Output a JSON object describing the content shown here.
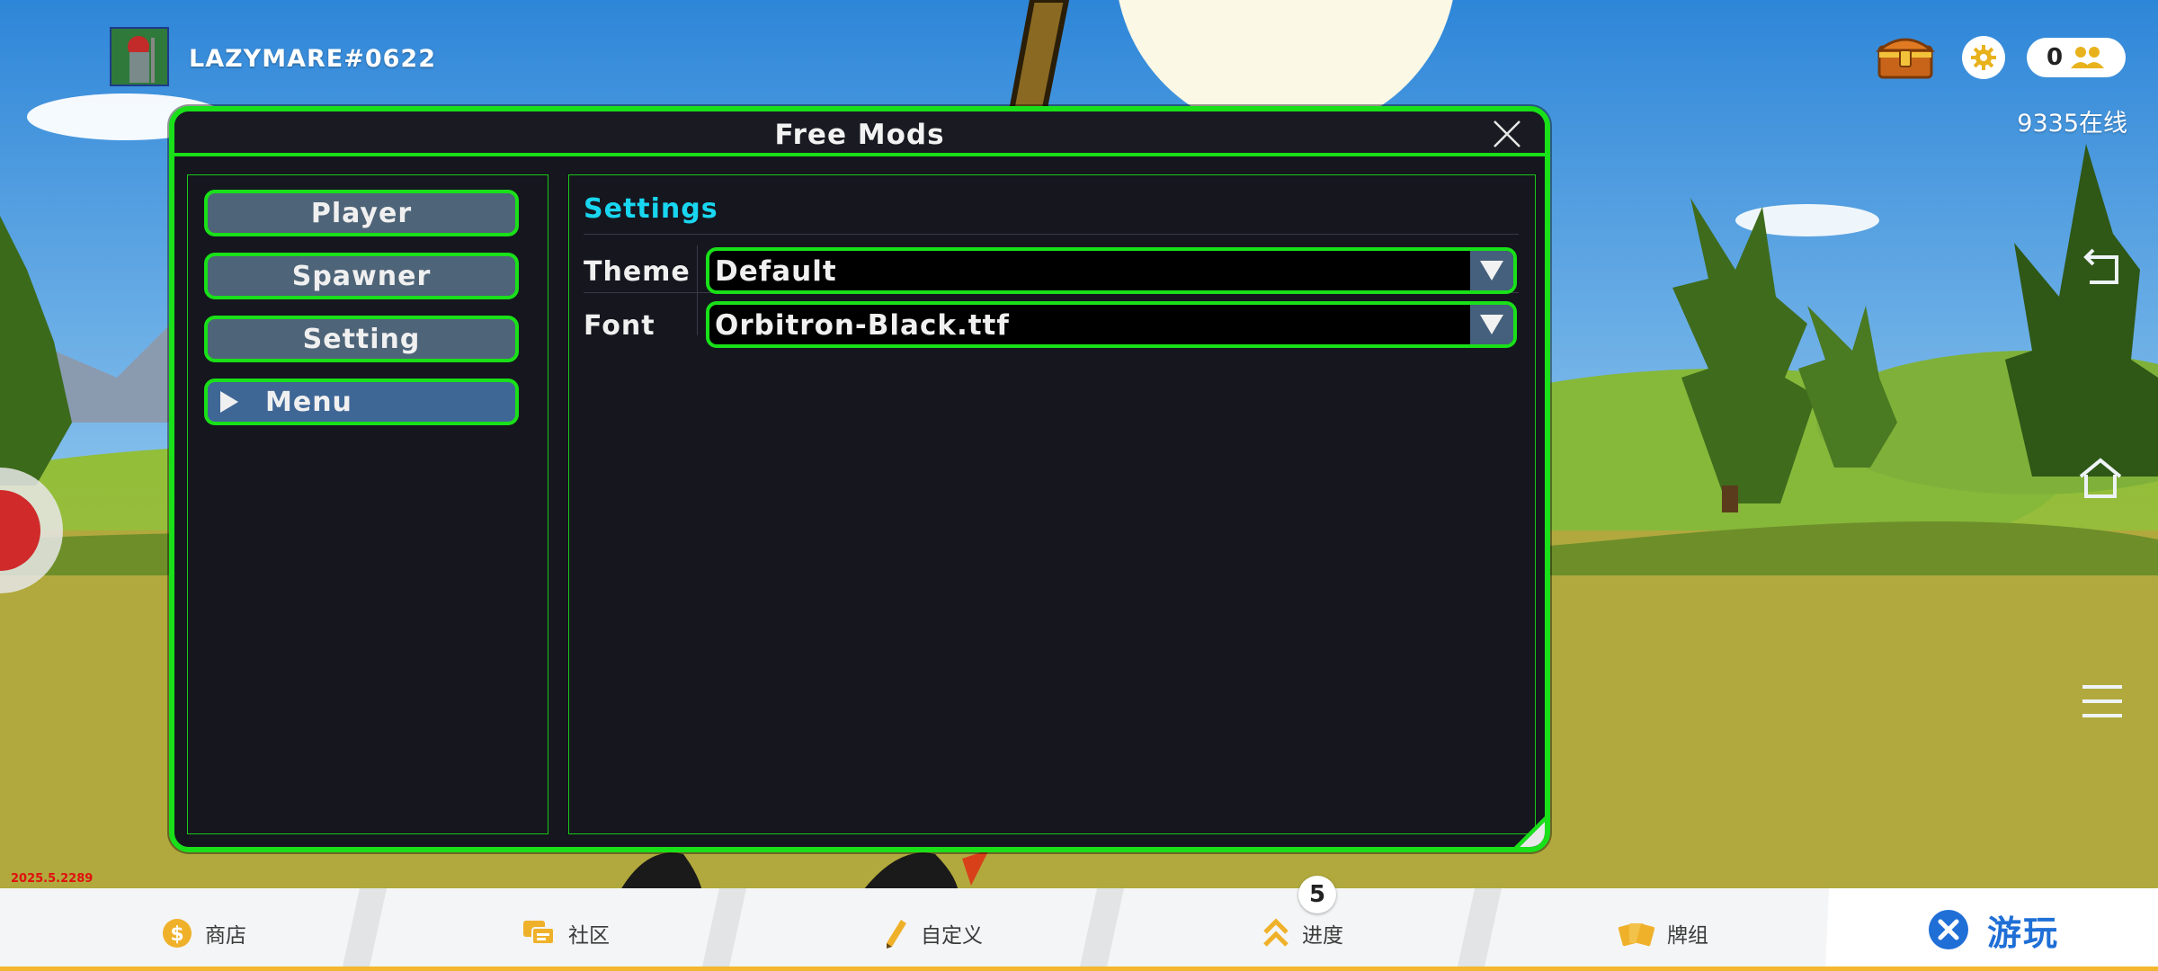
{
  "player": {
    "name": "LAZYMARE#0622"
  },
  "top_right": {
    "friends_count": "0",
    "online_status": "9335在线"
  },
  "version": "2025.5.2289",
  "modal": {
    "title": "Free Mods",
    "nav": [
      {
        "label": "Player",
        "active": false
      },
      {
        "label": "Spawner",
        "active": false
      },
      {
        "label": "Setting",
        "active": false
      },
      {
        "label": "Menu",
        "active": true
      }
    ],
    "section_title": "Settings",
    "theme": {
      "label": "Theme",
      "value": "Default"
    },
    "font": {
      "label": "Font",
      "value": "Orbitron-Black.ttf"
    }
  },
  "bottom_nav": {
    "shop": "商店",
    "community": "社区",
    "customize": "自定义",
    "progress": "进度",
    "progress_badge": "5",
    "decks": "牌组",
    "play": "游玩"
  },
  "colors": {
    "accent_green": "#19e019",
    "section_cyan": "#19d6f0",
    "play_blue": "#1f6fd6",
    "modal_bg": "#16161e"
  },
  "icons": [
    "chest-icon",
    "gear-icon",
    "friends-icon",
    "close-icon",
    "back-icon",
    "home-icon",
    "menu-icon",
    "coin-icon",
    "chat-icon",
    "pencil-icon",
    "chevron-up-icon",
    "cards-icon",
    "play-x-icon"
  ]
}
